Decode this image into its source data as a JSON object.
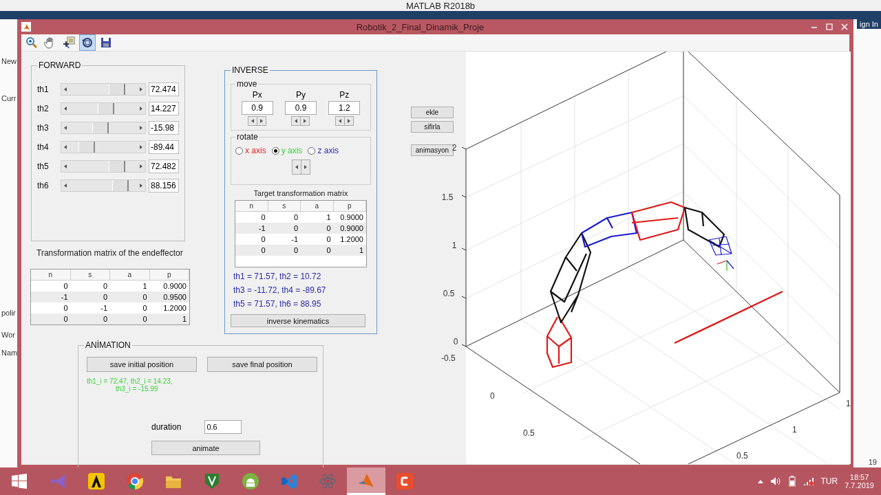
{
  "desktop": {
    "app_title": "MATLAB R2018b",
    "side_labels": [
      "New",
      "Curr",
      "polir",
      "Wor",
      "Nam"
    ],
    "sign_in": "ign In",
    "status": "19"
  },
  "figure": {
    "title": "Robotik_2_Final_Dinamik_Proje",
    "toolbar": [
      {
        "kind": "zoom",
        "selected": false
      },
      {
        "kind": "pan",
        "selected": false
      },
      {
        "kind": "cursor",
        "selected": false
      },
      {
        "kind": "rotate",
        "selected": true
      },
      {
        "kind": "save",
        "selected": false
      }
    ]
  },
  "forward": {
    "title": "FORWARD",
    "joints": [
      {
        "label": "th1",
        "level": 0.7,
        "value": "72.474"
      },
      {
        "label": "th2",
        "level": 0.54,
        "value": "14.227"
      },
      {
        "label": "th3",
        "level": 0.46,
        "value": "-15.98"
      },
      {
        "label": "th4",
        "level": 0.25,
        "value": "-89.44"
      },
      {
        "label": "th5",
        "level": 0.7,
        "value": "72.482"
      },
      {
        "label": "th6",
        "level": 0.75,
        "value": "88.156"
      }
    ]
  },
  "endeffector": {
    "caption": "Transformation matrix of the endeffector",
    "columns": [
      "n",
      "s",
      "a",
      "p"
    ],
    "rows": [
      [
        "0",
        "0",
        "1",
        "0.9000"
      ],
      [
        "-1",
        "0",
        "0",
        "0.9500"
      ],
      [
        "0",
        "-1",
        "0",
        "1.2000"
      ],
      [
        "0",
        "0",
        "0",
        "1"
      ]
    ]
  },
  "inverse": {
    "title": "INVERSE",
    "move": {
      "title": "move",
      "fields": [
        {
          "label": "Px",
          "value": "0.9"
        },
        {
          "label": "Py",
          "value": "0.9"
        },
        {
          "label": "Pz",
          "value": "1.2"
        }
      ]
    },
    "rotate": {
      "title": "rotate",
      "options": [
        {
          "label": "x axis",
          "selected": false,
          "color": "#e02828"
        },
        {
          "label": "y axis",
          "selected": true,
          "color": "#3ad23a"
        },
        {
          "label": "z axis",
          "selected": false,
          "color": "#2828c8"
        }
      ]
    },
    "target": {
      "caption": "Target transformation matrix",
      "columns": [
        "n",
        "s",
        "a",
        "p"
      ],
      "rows": [
        [
          "0",
          "0",
          "1",
          "0.9000"
        ],
        [
          "-1",
          "0",
          "0",
          "0.9000"
        ],
        [
          "0",
          "-1",
          "0",
          "1.2000"
        ],
        [
          "0",
          "0",
          "0",
          "1"
        ]
      ]
    },
    "solution": [
      "th1 = 71.57, th2 = 10.72",
      "th3 = -11.72, th4 = -89.67",
      "th5 = 71.57, th6 = 88.95"
    ],
    "button": "inverse kinematics"
  },
  "side_buttons": [
    "ekle",
    "sifirla",
    "animasyon"
  ],
  "animation": {
    "title": "ANİMATION",
    "buttons": [
      "save initial position",
      "save final position"
    ],
    "status": [
      "th1_i = 72.47, th2_i = 14.23,",
      "th3_i = -15.99"
    ],
    "duration_label": "duration",
    "duration_value": "0.6",
    "animate_button": "animate"
  },
  "plot": {
    "z_ticks": [
      "0",
      "0.5",
      "1",
      "1.5",
      "2"
    ],
    "x_ticks": [
      "-0.5",
      "0",
      "0.5"
    ],
    "y_ticks": [
      "0.5",
      "1",
      "1"
    ]
  },
  "taskbar": {
    "apps": [
      {
        "kind": "bowtie",
        "selected": false
      },
      {
        "kind": "triangle",
        "selected": false
      },
      {
        "kind": "browser",
        "selected": false
      },
      {
        "kind": "folder",
        "selected": false
      },
      {
        "kind": "shield",
        "selected": false
      },
      {
        "kind": "robot",
        "selected": false
      },
      {
        "kind": "ribbon",
        "selected": false
      },
      {
        "kind": "atom",
        "selected": false
      },
      {
        "kind": "peak",
        "selected": true
      },
      {
        "kind": "square",
        "selected": false
      }
    ],
    "language": "TUR",
    "time": "18:57",
    "date": "7.7.2019"
  }
}
